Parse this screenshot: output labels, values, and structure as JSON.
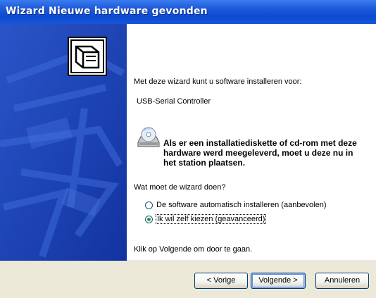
{
  "window": {
    "title": "Wizard Nieuwe hardware gevonden"
  },
  "content": {
    "intro": "Met deze wizard kunt u software installeren voor:",
    "device": "USB-Serial Controller",
    "disk_notice": "Als er een installatiediskette of cd-rom met deze hardware werd meegeleverd, moet u deze nu in het station plaatsen.",
    "question": "Wat moet de wizard doen?",
    "options": [
      {
        "label": "De software automatisch installeren (aanbevolen)",
        "selected": false
      },
      {
        "label": "Ik wil zelf kiezen (geavanceerd)",
        "selected": true
      }
    ],
    "continue_hint": "Klik op Volgende om door te gaan."
  },
  "buttons": {
    "back": "< Vorige",
    "next": "Volgende >",
    "cancel": "Annuleren"
  },
  "colors": {
    "title_bar": "#0a4bd2",
    "banner": "#1a3fb0",
    "radio_selected": "#21a121"
  },
  "icons": [
    "hardware-wizard-icon",
    "cd-rom-icon"
  ]
}
